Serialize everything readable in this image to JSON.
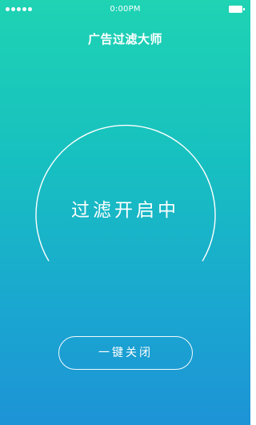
{
  "status_bar": {
    "time": "0:00PM",
    "signal_icon": "signal-dots-icon",
    "battery_icon": "battery-icon"
  },
  "header": {
    "title": "广告过滤大师"
  },
  "filter_ring": {
    "status_text": "过滤开启中"
  },
  "actions": {
    "one_key_off_label": "一键关闭"
  },
  "colors": {
    "gradient_top": "#1fd3b3",
    "gradient_bottom": "#1d93d6",
    "foreground": "#ffffff"
  }
}
